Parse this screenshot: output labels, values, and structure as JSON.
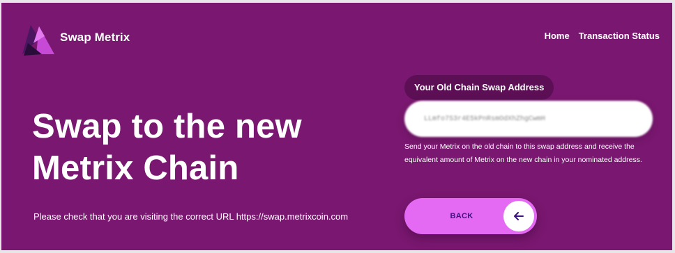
{
  "header": {
    "brand": "Swap Metrix",
    "logo_icon": "metrix-logo-icon",
    "nav": [
      {
        "label": "Home"
      },
      {
        "label": "Transaction Status"
      }
    ]
  },
  "hero": {
    "title_line1": "Swap to the new",
    "title_line2": "Metrix Chain",
    "url_notice": "Please check that you are visiting the correct URL https://swap.metrixcoin.com"
  },
  "swap": {
    "address_label": "Your Old Chain Swap Address",
    "address_value": "LLmfo7S3r4E5kPnRsmOdXhZhgCwmH",
    "help_text": "Send your Metrix on the old chain to this swap address and receive the equivalent amount of Metrix on the new chain in your nominated address.",
    "back_label": "BACK",
    "back_icon": "arrow-left-icon"
  },
  "colors": {
    "background": "#7a1770",
    "label_pill": "#5c0f55",
    "button": "#e46af4",
    "button_text": "#3a1380"
  }
}
